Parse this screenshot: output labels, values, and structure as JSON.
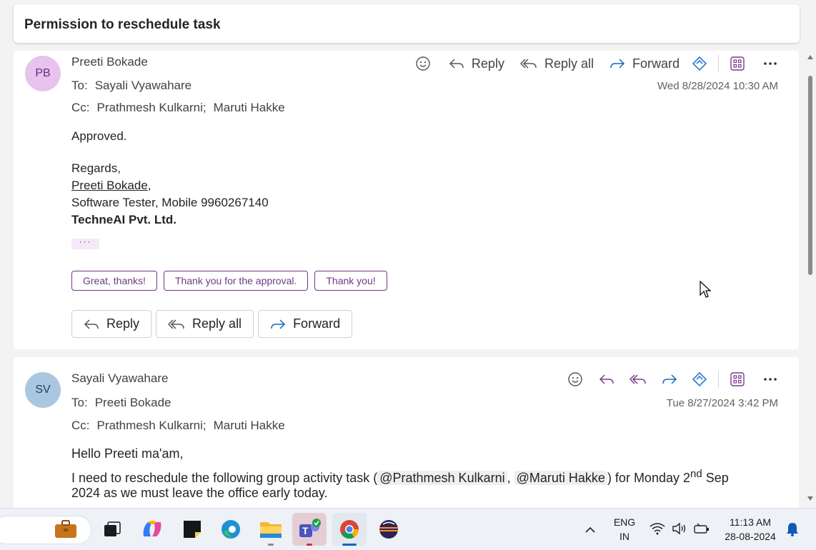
{
  "subject": "Permission to reschedule task",
  "messages": [
    {
      "initials": "PB",
      "avatar_color": "#e7c3ee",
      "avatar_text_color": "#6b2c7a",
      "sender": "Preeti Bokade",
      "to_label": "To:",
      "to": "Sayali Vyawahare",
      "cc_label": "Cc:",
      "cc": [
        "Prathmesh Kulkarni;",
        "Maruti Hakke"
      ],
      "date": "Wed 8/28/2024 10:30 AM",
      "actions": {
        "reply": "Reply",
        "reply_all": "Reply all",
        "forward": "Forward"
      },
      "body": {
        "line1": "Approved.",
        "regards": "Regards,",
        "name": "Preeti Bokade",
        "name_suffix": ",",
        "role": "Software Tester, Mobile 9960267140",
        "company": "TechneAI Pvt. Ltd.",
        "ellipsis": "···"
      },
      "suggested_replies": [
        "Great, thanks!",
        "Thank you for the approval.",
        "Thank you!"
      ],
      "bottom_actions": {
        "reply": "Reply",
        "reply_all": "Reply all",
        "forward": "Forward"
      }
    },
    {
      "initials": "SV",
      "avatar_color": "#a9c7e0",
      "avatar_text_color": "#1e3f5e",
      "sender": "Sayali Vyawahare",
      "to_label": "To:",
      "to": "Preeti Bokade",
      "cc_label": "Cc:",
      "cc": [
        "Prathmesh Kulkarni;",
        "Maruti Hakke"
      ],
      "date": "Tue 8/27/2024 3:42 PM",
      "body": {
        "greeting": "Hello Preeti ma'am,",
        "p1_a": "I need to reschedule the following group activity task (",
        "mention1": "@Prathmesh Kulkarni",
        "comma": ",",
        "mention2": "@Maruti Hakke",
        "p1_b": ") for Monday 2",
        "sup": "nd",
        "p1_c": " Sep",
        "p2": "2024 as we must leave the office early today."
      }
    }
  ],
  "taskbar": {
    "lang_top": "ENG",
    "lang_bottom": "IN",
    "time": "11:13 AM",
    "date": "28-08-2024",
    "icons": [
      "briefcase-icon",
      "taskview-icon",
      "copilot-icon",
      "sticky-notes-icon",
      "edge-icon",
      "file-explorer-icon",
      "teams-icon",
      "chrome-icon",
      "eclipse-icon"
    ]
  },
  "accent_color": "#6e3a84",
  "link_color": "#0f6cbd"
}
